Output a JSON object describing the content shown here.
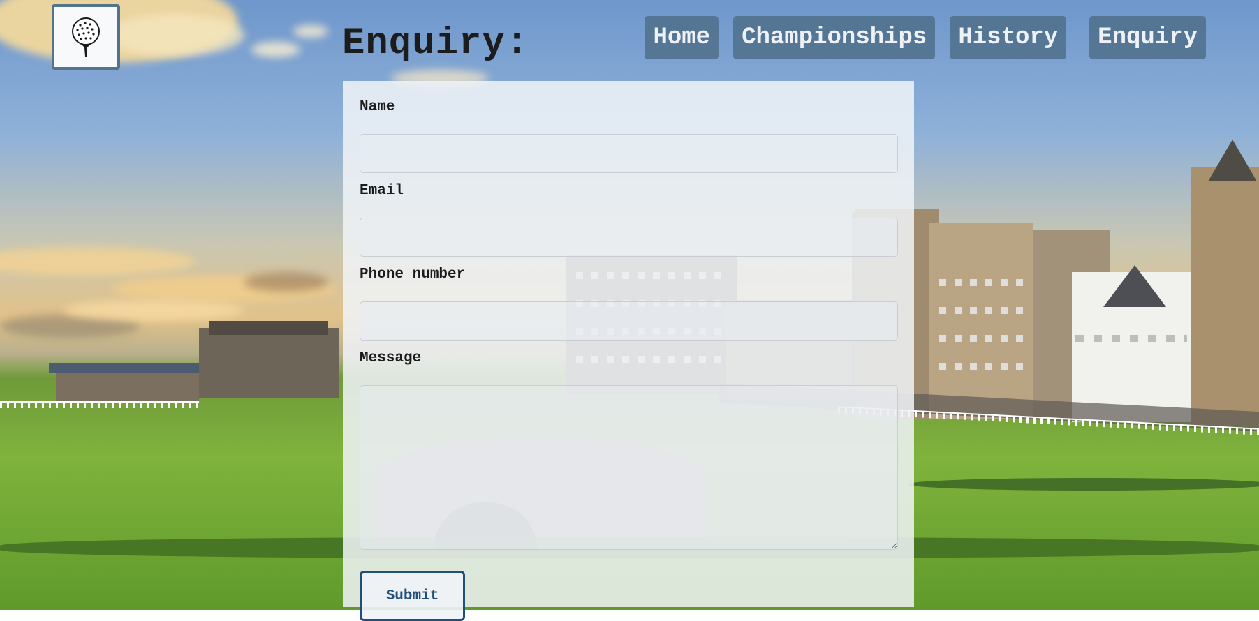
{
  "header": {
    "logo_icon": "golf-ball-on-tee-icon",
    "page_title": "Enquiry:"
  },
  "nav": {
    "items": [
      {
        "label": "Home"
      },
      {
        "label": "Championships"
      },
      {
        "label": "History"
      },
      {
        "label": "Enquiry"
      }
    ]
  },
  "form": {
    "fields": [
      {
        "label": "Name",
        "value": "",
        "placeholder": ""
      },
      {
        "label": "Email",
        "value": "",
        "placeholder": ""
      },
      {
        "label": "Phone number",
        "value": "",
        "placeholder": ""
      },
      {
        "label": "Message",
        "value": "",
        "placeholder": ""
      }
    ],
    "submit_label": "Submit"
  },
  "colors": {
    "nav_bg": "#4d6e87",
    "nav_text": "#eef2f6",
    "submit_border": "#1f4f7d",
    "logo_border": "#54738c"
  }
}
